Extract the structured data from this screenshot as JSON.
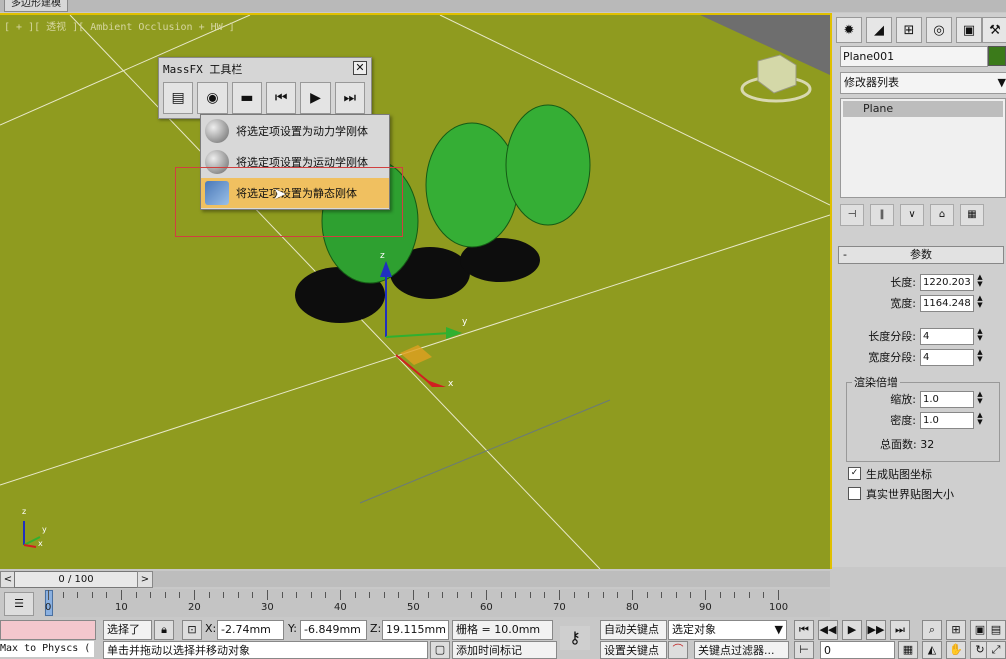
{
  "window": {
    "tab_label": "多边形建模"
  },
  "viewport": {
    "label": "[ + ][ 透视 ][ Ambient Occlusion + HW ]",
    "gizmo": {
      "x": "x",
      "y": "y",
      "z": "z"
    },
    "corner_axis": {
      "x": "x",
      "y": "y",
      "z": "z"
    }
  },
  "massfx": {
    "title": "MassFX 工具栏",
    "close": "✕",
    "menu": [
      {
        "label": "将选定项设置为动力学刚体",
        "highlighted": false
      },
      {
        "label": "将选定项设置为运动学刚体",
        "highlighted": false
      },
      {
        "label": "将选定项设置为静态刚体",
        "highlighted": true
      }
    ]
  },
  "panel": {
    "object_name": "Plane001",
    "object_color": "#3b7a1a",
    "modifier_list": "修改器列表",
    "stack_item": "Plane",
    "params_title": "参数",
    "length_label": "长度:",
    "length_value": "1220.203",
    "width_label": "宽度:",
    "width_value": "1164.248",
    "length_segs_label": "长度分段:",
    "length_segs_value": "4",
    "width_segs_label": "宽度分段:",
    "width_segs_value": "4",
    "render_mult_title": "渲染倍增",
    "scale_label": "缩放:",
    "scale_value": "1.0",
    "density_label": "密度:",
    "density_value": "1.0",
    "total_faces": "总面数: 32",
    "gen_map_coords": "生成贴图坐标",
    "gen_map_coords_checked": true,
    "real_world_map": "真实世界贴图大小",
    "real_world_map_checked": false
  },
  "timeline": {
    "slider_label": "0 / 100",
    "ticks": [
      "0",
      "10",
      "20",
      "30",
      "40",
      "50",
      "60",
      "70",
      "80",
      "90",
      "100"
    ]
  },
  "status": {
    "maxphys": "Max to Physcs (",
    "selected": "选择了",
    "x_label": "X:",
    "x_value": "-2.74mm",
    "y_label": "Y:",
    "y_value": "-6.849mm",
    "z_label": "Z:",
    "z_value": "19.115mm",
    "grid": "栅格 = 10.0mm",
    "auto_key": "自动关键点",
    "selected_object": "选定对象",
    "set_key": "设置关键点",
    "key_filters": "关键点过滤器...",
    "prompt": "单击并拖动以选择并移动对象",
    "add_time_tag": "添加时间标记",
    "frame": "0"
  }
}
